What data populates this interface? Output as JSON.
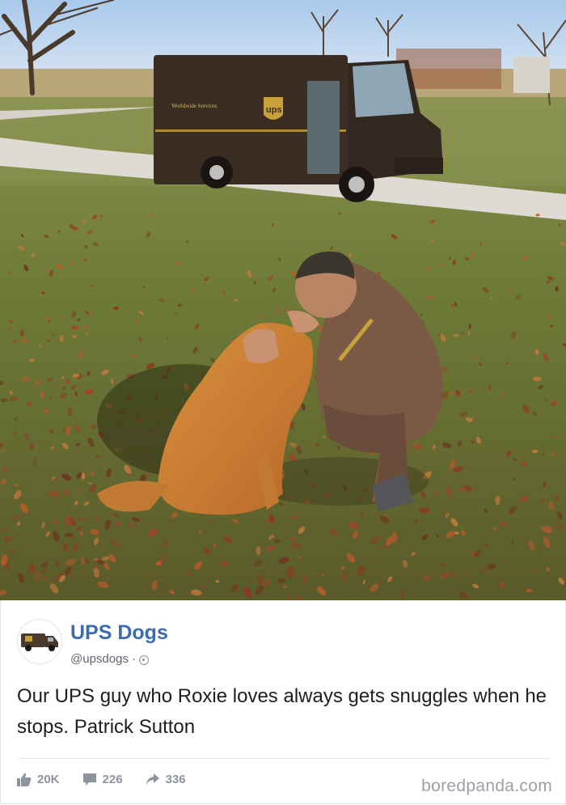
{
  "post": {
    "page_name": "UPS Dogs",
    "handle": "@upsdogs",
    "separator": "·",
    "text": "Our UPS guy who Roxie loves always gets snuggles when he stops. Patrick Sutton",
    "likes": "20K",
    "comments": "226",
    "shares": "336"
  },
  "truck": {
    "side_text": "Worldwide Services",
    "logo": "ups"
  },
  "footer": {
    "brand": "boredpanda.com"
  },
  "icons": {
    "like": "thumbs-up-icon",
    "comment": "comment-icon",
    "share": "share-icon",
    "privacy": "globe-icon"
  },
  "colors": {
    "page_name": "#3b6bb3",
    "ups_brown": "#3a2e24",
    "ups_gold": "#c9a13b"
  }
}
